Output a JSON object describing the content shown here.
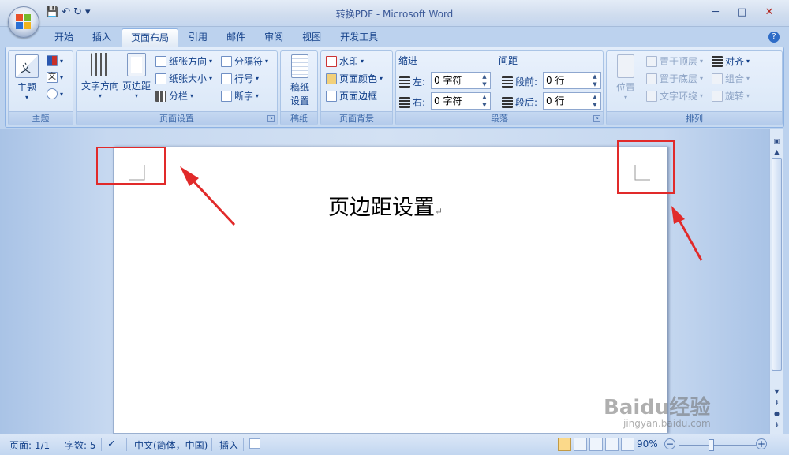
{
  "window": {
    "title": "转换PDF - Microsoft Word"
  },
  "qat": {
    "save": "💾",
    "undo": "↶",
    "redo": "↻",
    "more": "▾"
  },
  "window_controls": {
    "minimize": "─",
    "maximize": "□",
    "close": "✕"
  },
  "tabs": [
    "开始",
    "插入",
    "页面布局",
    "引用",
    "邮件",
    "审阅",
    "视图",
    "开发工具"
  ],
  "active_tab": "页面布局",
  "ribbon": {
    "theme": {
      "label": "主题",
      "btn_label": "主题",
      "small_color": "颜色",
      "small_font": "文",
      "small_effect": "效果"
    },
    "page_setup": {
      "label": "页面设置",
      "text_direction": "文字方向",
      "margins": "页边距",
      "orientation": "纸张方向",
      "size": "纸张大小",
      "columns": "分栏",
      "breaks": "分隔符",
      "line_numbers": "行号",
      "hyphenation": "断字"
    },
    "manuscript": {
      "label": "稿纸",
      "btn1": "稿纸",
      "btn2": "设置"
    },
    "background": {
      "label": "页面背景",
      "watermark": "水印",
      "page_color": "页面颜色",
      "page_border": "页面边框"
    },
    "paragraph": {
      "label": "段落",
      "indent_title": "缩进",
      "left_label": "左:",
      "left_value": "0 字符",
      "right_label": "右:",
      "right_value": "0 字符",
      "spacing_title": "间距",
      "before_label": "段前:",
      "before_value": "0 行",
      "after_label": "段后:",
      "after_value": "0 行"
    },
    "arrange": {
      "label": "排列",
      "position": "位置",
      "bring_front": "置于顶层",
      "send_back": "置于底层",
      "text_wrap": "文字环绕",
      "align": "对齐",
      "group": "组合",
      "rotate": "旋转"
    }
  },
  "document": {
    "heading": "页边距设置",
    "para_mark": "↵"
  },
  "status": {
    "page": "页面: 1/1",
    "words": "字数: 5",
    "language": "中文(简体，中国)",
    "mode": "插入",
    "zoom": "90%",
    "zoom_minus": "−",
    "zoom_plus": "+"
  },
  "watermark": {
    "brand": "Baidu经验",
    "url": "jingyan.baidu.com"
  },
  "colors": {
    "annotation_red": "#e12a2a",
    "ribbon_blue": "#d2e1f4",
    "text_blue": "#15428b"
  }
}
